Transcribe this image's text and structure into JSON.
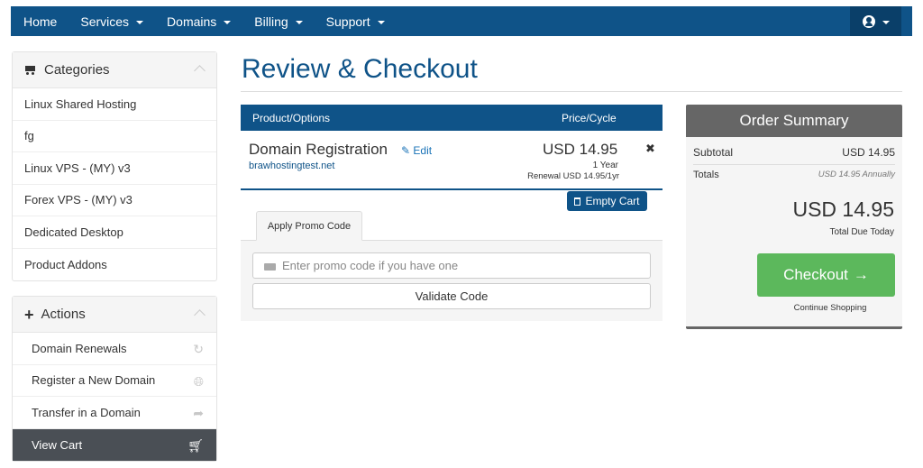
{
  "nav": {
    "items": [
      {
        "label": "Home",
        "dropdown": false
      },
      {
        "label": "Services",
        "dropdown": true
      },
      {
        "label": "Domains",
        "dropdown": true
      },
      {
        "label": "Billing",
        "dropdown": true
      },
      {
        "label": "Support",
        "dropdown": true
      }
    ],
    "account_icon": "user-circle-icon"
  },
  "sidebar": {
    "categories": {
      "title": "Categories",
      "items": [
        "Linux Shared Hosting",
        "fg",
        "Linux VPS - (MY) v3",
        "Forex VPS - (MY) v3",
        "Dedicated Desktop",
        "Product Addons"
      ]
    },
    "actions": {
      "title": "Actions",
      "items": [
        {
          "label": "Domain Renewals",
          "icon": "refresh-icon"
        },
        {
          "label": "Register a New Domain",
          "icon": "globe-icon"
        },
        {
          "label": "Transfer in a Domain",
          "icon": "share-arrow-icon"
        },
        {
          "label": "View Cart",
          "icon": "cart-icon"
        }
      ]
    }
  },
  "main": {
    "title": "Review & Checkout",
    "cart_header": {
      "product": "Product/Options",
      "price": "Price/Cycle"
    },
    "item": {
      "name": "Domain Registration",
      "edit": "Edit",
      "domain": "brawhostingtest.net",
      "price": "USD 14.95",
      "cycle": "1 Year",
      "renewal": "Renewal USD 14.95/1yr"
    },
    "empty_cart": "Empty Cart",
    "promo": {
      "tab": "Apply Promo Code",
      "placeholder": "Enter promo code if you have one",
      "validate": "Validate Code"
    }
  },
  "summary": {
    "title": "Order Summary",
    "subtotal_label": "Subtotal",
    "subtotal_value": "USD 14.95",
    "totals_label": "Totals",
    "totals_value": "USD 14.95 Annually",
    "total_due": "USD 14.95",
    "total_due_label": "Total Due Today",
    "checkout": "Checkout",
    "continue": "Continue Shopping"
  },
  "colors": {
    "brand": "#0f5388",
    "checkout": "#5cb85c",
    "summary_head": "#666666"
  }
}
